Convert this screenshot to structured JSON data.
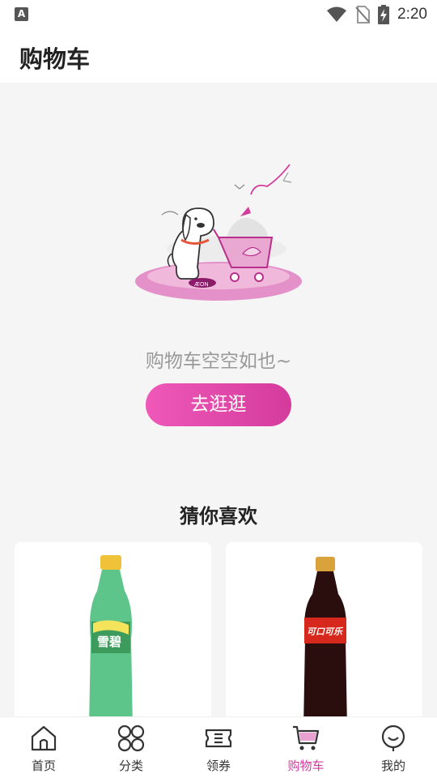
{
  "status_bar": {
    "left_icon": "A",
    "time": "2:20",
    "icons": [
      "wifi-icon",
      "no-sim-icon",
      "battery-charging-icon"
    ]
  },
  "header": {
    "title": "购物车"
  },
  "empty_state": {
    "illustration": "dog-with-shopping-cart-illustration",
    "brand_text": "ÆON",
    "message": "购物车空空如也~",
    "button_label": "去逛逛"
  },
  "recommendations": {
    "title": "猜你喜欢",
    "products": [
      {
        "image": "sprite-bottle",
        "label_text": "雪碧"
      },
      {
        "image": "coca-cola-bottle",
        "label_text": "可口可乐"
      }
    ]
  },
  "tab_bar": {
    "accent_color": "#d43b9c",
    "items": [
      {
        "label": "首页",
        "icon": "home-icon",
        "active": false
      },
      {
        "label": "分类",
        "icon": "category-icon",
        "active": false
      },
      {
        "label": "领券",
        "icon": "coupon-icon",
        "active": false
      },
      {
        "label": "购物车",
        "icon": "cart-icon",
        "active": true
      },
      {
        "label": "我的",
        "icon": "profile-icon",
        "active": false
      }
    ]
  }
}
